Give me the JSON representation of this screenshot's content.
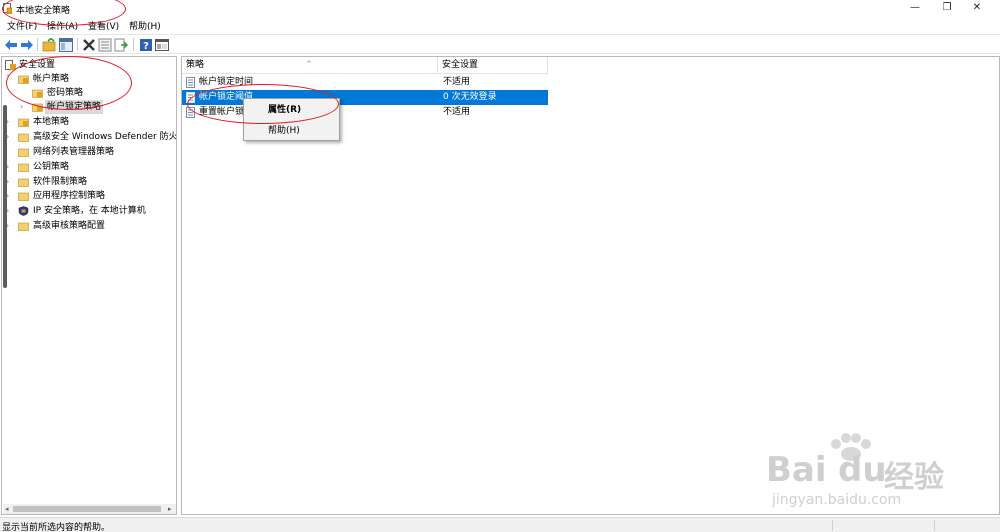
{
  "window": {
    "title": "本地安全策略",
    "buttons": {
      "minimize": "—",
      "maximize": "❐",
      "close": "✕"
    }
  },
  "menu": [
    "文件(F)",
    "操作(A)",
    "查看(V)",
    "帮助(H)"
  ],
  "toolbar": {
    "icons": [
      "back-arrow-icon",
      "forward-arrow-icon",
      "up-folder-icon",
      "show-hide-tree-icon",
      "delete-icon",
      "properties-icon",
      "export-list-icon",
      "help-icon",
      "console-icon"
    ]
  },
  "tree": {
    "root": "安全设置",
    "items": [
      {
        "label": "帐户策略",
        "expanded": true,
        "level": 1
      },
      {
        "label": "密码策略",
        "level": 2
      },
      {
        "label": "帐户锁定策略",
        "level": 2,
        "selected": true
      },
      {
        "label": "本地策略",
        "level": 1
      },
      {
        "label": "高级安全 Windows Defender 防火墙",
        "level": 1
      },
      {
        "label": "网络列表管理器策略",
        "level": 1
      },
      {
        "label": "公钥策略",
        "level": 1
      },
      {
        "label": "软件限制策略",
        "level": 1
      },
      {
        "label": "应用程序控制策略",
        "level": 1
      },
      {
        "label": "IP 安全策略，在 本地计算机",
        "level": 1
      },
      {
        "label": "高级审核策略配置",
        "level": 1
      }
    ]
  },
  "list": {
    "columns": [
      "策略",
      "安全设置"
    ],
    "rows": [
      {
        "policy": "帐户锁定时间",
        "setting": "不适用"
      },
      {
        "policy": "帐户锁定阈值",
        "setting": "0 次无效登录",
        "selected": true
      },
      {
        "policy": "重置帐户锁",
        "setting": "不适用"
      }
    ]
  },
  "context_menu": {
    "items": [
      "属性(R)",
      "帮助(H)"
    ]
  },
  "status": {
    "text": "显示当前所选内容的帮助。"
  },
  "watermark": {
    "brand": "Bai",
    "brand2": "du",
    "cn": "经验",
    "url": "jingyan.baidu.com"
  },
  "colors": {
    "selection": "#0078d7",
    "annotation": "#e21b23"
  }
}
